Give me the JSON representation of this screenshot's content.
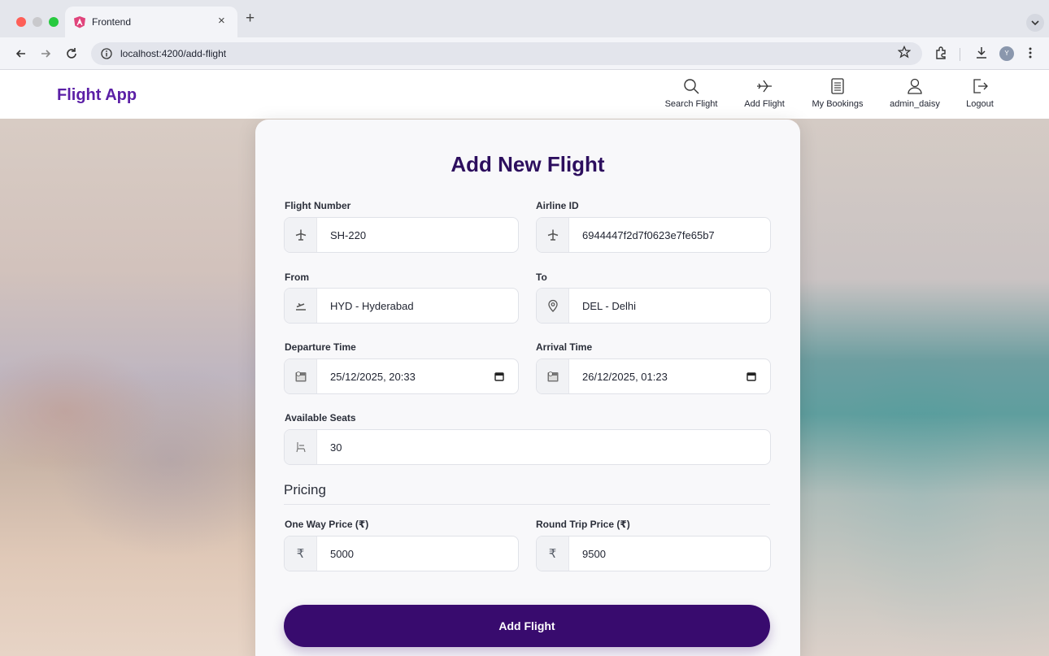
{
  "browser": {
    "tab_title": "Frontend",
    "url": "localhost:4200/add-flight",
    "avatar_letter": "Y"
  },
  "header": {
    "brand": "Flight App",
    "nav": [
      {
        "label": "Search Flight",
        "icon": "search-icon"
      },
      {
        "label": "Add Flight",
        "icon": "airplane-icon"
      },
      {
        "label": "My Bookings",
        "icon": "document-icon"
      },
      {
        "label": "admin_daisy",
        "icon": "user-icon"
      },
      {
        "label": "Logout",
        "icon": "logout-icon"
      }
    ]
  },
  "form": {
    "title": "Add New Flight",
    "flight_number": {
      "label": "Flight Number",
      "value": "SH-220",
      "icon": "airplane-icon"
    },
    "airline_id": {
      "label": "Airline ID",
      "value": "6944447f2d7f0623e7fe65b7",
      "icon": "airplane-icon"
    },
    "from": {
      "label": "From",
      "value": "HYD - Hyderabad",
      "icon": "takeoff-icon"
    },
    "to": {
      "label": "To",
      "value": "DEL - Delhi",
      "icon": "location-pin-icon"
    },
    "departure_time": {
      "label": "Departure Time",
      "value": "25/12/2025, 20:33",
      "icon": "clock-calendar-icon"
    },
    "arrival_time": {
      "label": "Arrival Time",
      "value": "26/12/2025, 01:23",
      "icon": "clock-calendar-icon"
    },
    "available_seats": {
      "label": "Available Seats",
      "value": "30",
      "icon": "seat-icon"
    },
    "pricing_title": "Pricing",
    "one_way_price": {
      "label": "One Way Price (₹)",
      "value": "5000",
      "icon": "rupee-icon",
      "symbol": "₹"
    },
    "round_trip_price": {
      "label": "Round Trip Price (₹)",
      "value": "9500",
      "icon": "rupee-icon",
      "symbol": "₹"
    },
    "submit_label": "Add Flight"
  },
  "colors": {
    "brand": "#5b1fa6",
    "title": "#2d0f5e",
    "primary_button": "#380b6e"
  }
}
